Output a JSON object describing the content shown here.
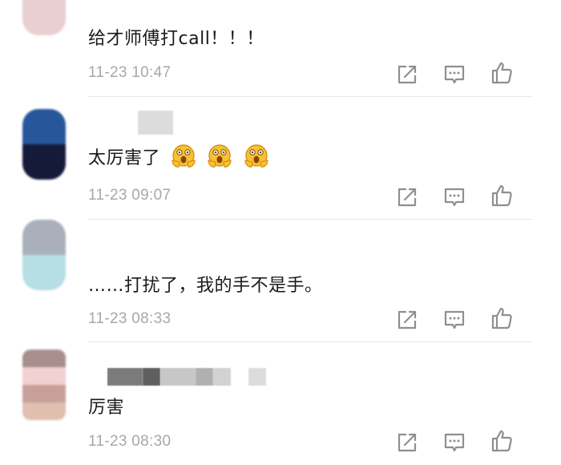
{
  "comments": [
    {
      "text": "给才师傅打call！！！",
      "time": "11-23 10:47"
    },
    {
      "text": "太厉害了",
      "time": "11-23 09:07"
    },
    {
      "text": "……打扰了，我的手不是手。",
      "time": "11-23 08:33"
    },
    {
      "text": "厉害",
      "time": "11-23 08:30"
    }
  ],
  "actions": {
    "share_icon": "share-icon",
    "comment_icon": "comment-icon",
    "like_icon": "like-icon"
  },
  "colors": {
    "emoji": "#f7c231",
    "emoji_outline": "#d98f12",
    "icon": "#9a9a9a",
    "time": "#a8a8a8"
  }
}
